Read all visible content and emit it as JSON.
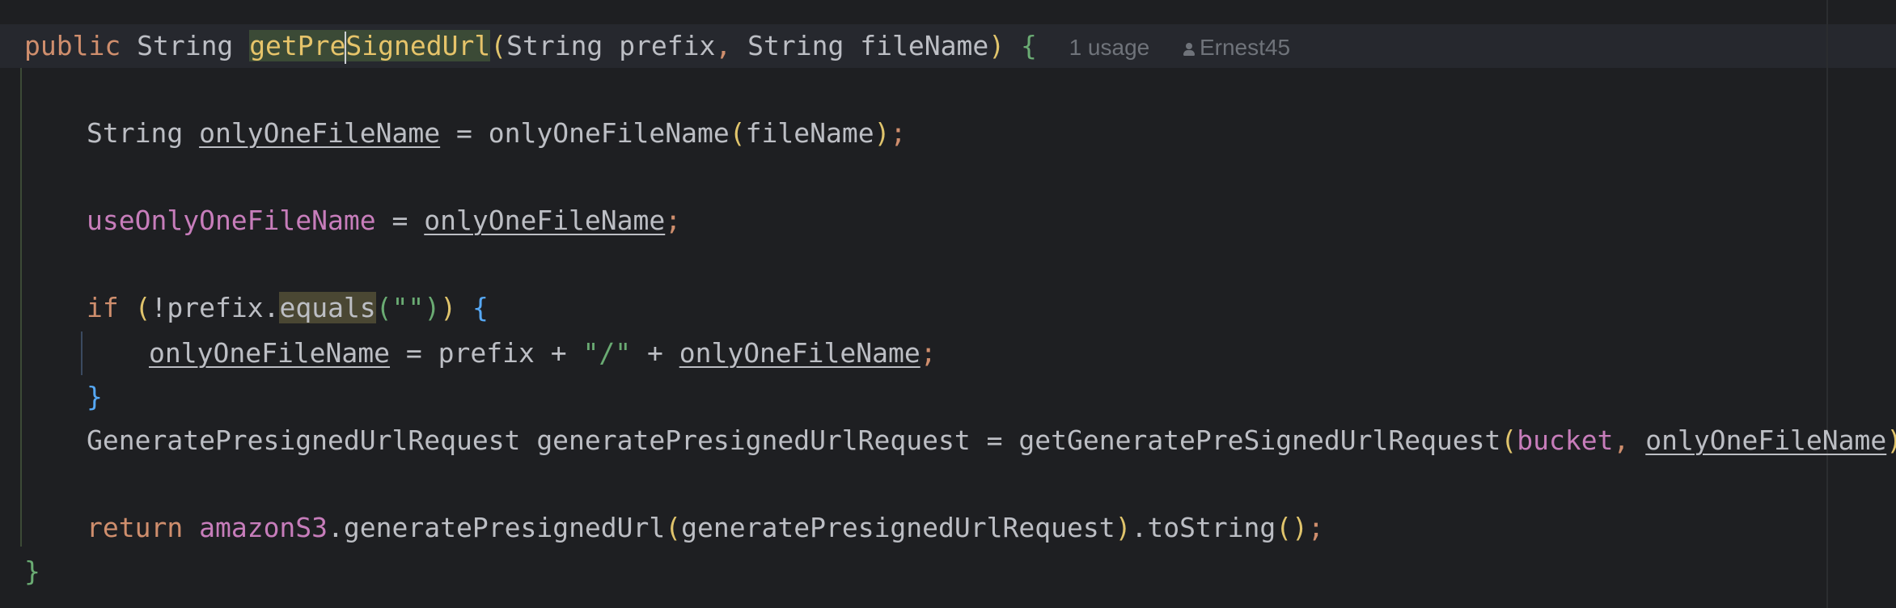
{
  "code": {
    "line1": {
      "kw_public": "public",
      "type": "String",
      "method_before_caret": "getPre",
      "method_after_caret": "SignedUrl",
      "open_paren": "(",
      "param1_type": "String",
      "param1_name": "prefix",
      "comma": ",",
      "param2_type": "String",
      "param2_name": "fileName",
      "close_paren": ")",
      "open_brace": "{"
    },
    "inlay": {
      "usages": "1 usage",
      "author": "Ernest45"
    },
    "line2": {
      "type": "String",
      "var": "onlyOneFileName",
      "eq": "=",
      "call": "onlyOneFileName",
      "open_paren": "(",
      "arg": "fileName",
      "close_paren": ")",
      "semi": ";"
    },
    "line3": {
      "field": "useOnlyOneFileName",
      "eq": "=",
      "var": "onlyOneFileName",
      "semi": ";"
    },
    "line4": {
      "kw_if": "if",
      "open_paren": "(",
      "not": "!",
      "obj": "prefix",
      "dot": ".",
      "method": "equals",
      "inner_open": "(",
      "str": "\"\"",
      "inner_close": ")",
      "close_paren": ")",
      "open_brace": "{"
    },
    "line5": {
      "var": "onlyOneFileName",
      "eq": "=",
      "obj": "prefix",
      "plus1": "+",
      "str": "\"/\"",
      "plus2": "+",
      "var2": "onlyOneFileName",
      "semi": ";"
    },
    "line6": {
      "close_brace": "}"
    },
    "line7": {
      "type": "GeneratePresignedUrlRequest",
      "var": "generatePresignedUrlRequest",
      "eq": "=",
      "call": "getGeneratePreSignedUrlRequest",
      "open_paren": "(",
      "arg1": "bucket",
      "comma": ",",
      "arg2": "onlyOneFileName",
      "close_paren": ")",
      "semi": ";"
    },
    "line8": {
      "kw_return": "return",
      "field": "amazonS3",
      "dot1": ".",
      "method": "generatePresignedUrl",
      "open_paren": "(",
      "arg": "generatePresignedUrlRequest",
      "close_paren": ")",
      "dot2": ".",
      "method2": "toString",
      "parens": "()",
      "semi": ";"
    },
    "line9": {
      "close_brace": "}"
    }
  },
  "colors": {
    "background": "#1e1f22",
    "current_line": "#26282e",
    "keyword": "#cf8e6d",
    "string": "#6aab73",
    "field": "#c77dbb",
    "text": "#bcbec4",
    "inlay_hint": "#6f737a",
    "declaration_highlight": "#3b4a36",
    "usage_highlight": "#4a4733"
  }
}
